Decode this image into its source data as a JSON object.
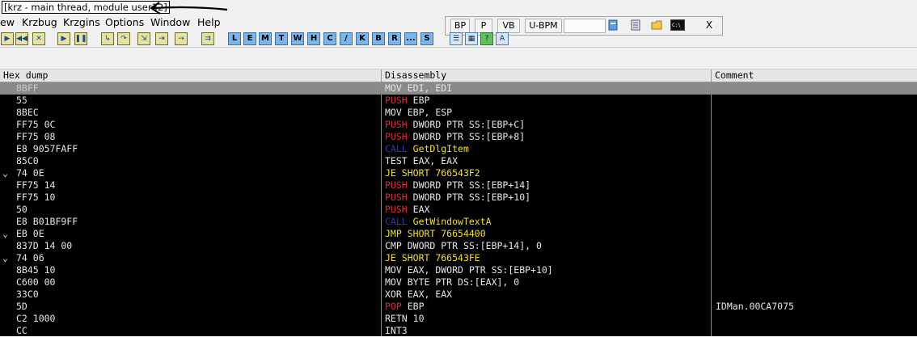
{
  "window": {
    "title": "[krz - main thread, module user32]"
  },
  "menu": {
    "items": [
      "ew",
      "Krzbug",
      "Krzgins",
      "Options",
      "Window",
      "Help"
    ]
  },
  "bp_toolbar": {
    "buttons": [
      "BP",
      "P",
      "VB",
      "U-BPM"
    ],
    "close": "X",
    "icons": [
      "module-icon",
      "notes-icon",
      "folder-icon",
      "console-icon"
    ]
  },
  "toolbar": {
    "icons": [
      "open-icon",
      "restart-icon",
      "close-icon",
      "run-icon",
      "pause-icon",
      "step-into-icon",
      "step-over-icon",
      "trace-into-icon",
      "trace-over-icon",
      "execute-till-return-icon",
      "goto-icon"
    ],
    "letters": [
      "L",
      "E",
      "M",
      "T",
      "W",
      "H",
      "C",
      "/",
      "K",
      "B",
      "R",
      "...",
      "S"
    ],
    "extra_icons": [
      "list-icon",
      "grid-icon",
      "help-icon",
      "font-icon"
    ]
  },
  "table": {
    "headers": [
      "Hex dump",
      "Disassembly",
      "Comment"
    ],
    "rows": [
      {
        "mark": "",
        "hex": "8BFF",
        "mn": "MOV",
        "op": "EDI, EDI",
        "kind": "mov",
        "comment": ""
      },
      {
        "mark": "",
        "hex": "55",
        "mn": "PUSH",
        "op": "EBP",
        "kind": "push",
        "comment": ""
      },
      {
        "mark": "",
        "hex": "8BEC",
        "mn": "MOV",
        "op": "EBP, ESP",
        "kind": "mov",
        "comment": ""
      },
      {
        "mark": "",
        "hex": "FF75 0C",
        "mn": "PUSH",
        "op": "DWORD PTR SS:[EBP+C]",
        "kind": "push",
        "comment": ""
      },
      {
        "mark": "",
        "hex": "FF75 08",
        "mn": "PUSH",
        "op": "DWORD PTR SS:[EBP+8]",
        "kind": "push",
        "comment": ""
      },
      {
        "mark": "",
        "hex": "E8 9057FAFF",
        "mn": "CALL",
        "op": "GetDlgItem",
        "kind": "call",
        "comment": ""
      },
      {
        "mark": "",
        "hex": "85C0",
        "mn": "TEST",
        "op": "EAX, EAX",
        "kind": "mov",
        "comment": ""
      },
      {
        "mark": "⌄",
        "hex": "74 0E",
        "mn": "JE",
        "op": "SHORT 766543F2",
        "kind": "jmp",
        "comment": ""
      },
      {
        "mark": "",
        "hex": "FF75 14",
        "mn": "PUSH",
        "op": "DWORD PTR SS:[EBP+14]",
        "kind": "push",
        "comment": ""
      },
      {
        "mark": "",
        "hex": "FF75 10",
        "mn": "PUSH",
        "op": "DWORD PTR SS:[EBP+10]",
        "kind": "push",
        "comment": ""
      },
      {
        "mark": "",
        "hex": "50",
        "mn": "PUSH",
        "op": "EAX",
        "kind": "push",
        "comment": ""
      },
      {
        "mark": "",
        "hex": "E8 B01BF9FF",
        "mn": "CALL",
        "op": "GetWindowTextA",
        "kind": "call",
        "comment": ""
      },
      {
        "mark": "⌄",
        "hex": "EB 0E",
        "mn": "JMP",
        "op": "SHORT 76654400",
        "kind": "jmp",
        "comment": ""
      },
      {
        "mark": "",
        "hex": "837D 14 00",
        "mn": "CMP",
        "op": "DWORD PTR SS:[EBP+14], 0",
        "kind": "mov",
        "comment": ""
      },
      {
        "mark": "⌄",
        "hex": "74 06",
        "mn": "JE",
        "op": "SHORT 766543FE",
        "kind": "jmp",
        "comment": ""
      },
      {
        "mark": "",
        "hex": "8B45 10",
        "mn": "MOV",
        "op": "EAX, DWORD PTR SS:[EBP+10]",
        "kind": "mov",
        "comment": ""
      },
      {
        "mark": "",
        "hex": "C600 00",
        "mn": "MOV",
        "op": "BYTE PTR DS:[EAX], 0",
        "kind": "mov",
        "comment": ""
      },
      {
        "mark": "",
        "hex": "33C0",
        "mn": "XOR",
        "op": "EAX, EAX",
        "kind": "mov",
        "comment": ""
      },
      {
        "mark": "",
        "hex": "5D",
        "mn": "POP",
        "op": "EBP",
        "kind": "pop",
        "comment": "IDMan.00CA7075"
      },
      {
        "mark": "",
        "hex": "C2 1000",
        "mn": "RETN",
        "op": "10",
        "kind": "mov",
        "comment": ""
      },
      {
        "mark": "",
        "hex": "CC",
        "mn": "INT3",
        "op": "",
        "kind": "mov",
        "comment": ""
      }
    ]
  }
}
